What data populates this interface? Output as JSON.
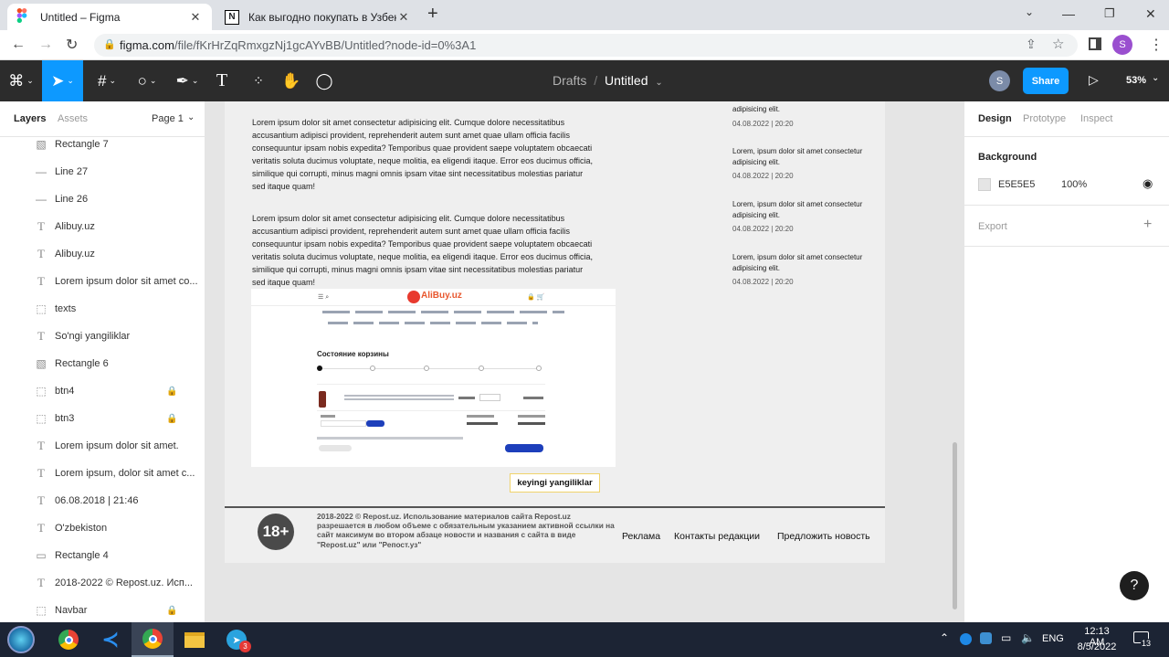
{
  "browser": {
    "tabs": [
      {
        "title": "Untitled – Figma",
        "close": "✕"
      },
      {
        "title": "Как выгодно покупать в Узбеки",
        "close": "✕"
      }
    ],
    "new_tab": "+",
    "url_host": "figma.com",
    "url_path": "/file/fKrHrZqRmxgzNj1gcAYvBB/Untitled?node-id=0%3A1",
    "profile_initial": "S"
  },
  "figma": {
    "breadcrumb_parent": "Drafts",
    "breadcrumb_sep": "/",
    "file_name": "Untitled",
    "user_initial": "S",
    "share_label": "Share",
    "zoom": "53%"
  },
  "layers_panel": {
    "tab_layers": "Layers",
    "tab_assets": "Assets",
    "page": "Page 1",
    "items": [
      {
        "icon": "image-icon",
        "name": "Rectangle 7",
        "locked": false
      },
      {
        "icon": "line-icon",
        "name": "Line 27",
        "locked": false
      },
      {
        "icon": "line-icon",
        "name": "Line 26",
        "locked": false
      },
      {
        "icon": "text-icon",
        "name": "Alibuy.uz",
        "locked": false
      },
      {
        "icon": "text-icon",
        "name": "Alibuy.uz",
        "locked": false
      },
      {
        "icon": "text-icon",
        "name": "Lorem ipsum dolor sit amet co...",
        "locked": false
      },
      {
        "icon": "frame-icon",
        "name": "texts",
        "locked": false
      },
      {
        "icon": "text-icon",
        "name": "So'ngi yangiliklar",
        "locked": false
      },
      {
        "icon": "image-icon",
        "name": "Rectangle 6",
        "locked": false
      },
      {
        "icon": "frame-icon",
        "name": "btn4",
        "locked": true
      },
      {
        "icon": "frame-icon",
        "name": "btn3",
        "locked": true
      },
      {
        "icon": "text-icon",
        "name": "Lorem ipsum dolor sit amet.",
        "locked": false
      },
      {
        "icon": "text-icon",
        "name": "Lorem ipsum, dolor sit amet c...",
        "locked": false
      },
      {
        "icon": "text-icon",
        "name": "06.08.2018 | 21:46",
        "locked": false
      },
      {
        "icon": "text-icon",
        "name": "O'zbekiston",
        "locked": false
      },
      {
        "icon": "rect-icon",
        "name": "Rectangle 4",
        "locked": false
      },
      {
        "icon": "text-icon",
        "name": "2018-2022 © Repost.uz. Исп...",
        "locked": false
      },
      {
        "icon": "frame-icon",
        "name": "Navbar",
        "locked": true
      }
    ]
  },
  "design_panel": {
    "tab_design": "Design",
    "tab_prototype": "Prototype",
    "tab_inspect": "Inspect",
    "background_label": "Background",
    "background_hex": "E5E5E5",
    "background_opacity": "100%",
    "export_label": "Export",
    "add": "+"
  },
  "canvas": {
    "paragraph": "Lorem ipsum dolor sit amet consectetur adipisicing elit. Cumque dolore necessitatibus accusantium adipisci provident, reprehenderit autem sunt amet quae ullam officia facilis consequuntur ipsam nobis expedita? Temporibus quae provident saepe voluptatem obcaecati veritatis soluta ducimus voluptate, neque molitia, ea eligendi itaque. Error eos ducimus officia, similique qui corrupti, minus magni omnis ipsam vitae sint necessitatibus molestias pariatur sed itaque quam!",
    "paragraph2": "Lorem ipsum dolor sit amet consectetur adipisicing elit. Cumque dolore necessitatibus accusantium adipisci provident, reprehenderit autem sunt amet quae ullam officia facilis consequuntur ipsam nobis expedita? Temporibus quae provident saepe voluptatem obcaecati veritatis soluta ducimus voluptate, neque molitia, ea eligendi itaque. Error eos ducimus officia, similique qui corrupti, minus magni omnis ipsam vitae sint necessitatibus molestias pariatur sed itaque quam!",
    "news_top_fragment": "adipisicing elit.",
    "news_top_date": "04.08.2022 | 20:20",
    "news": [
      {
        "text": "Lorem, ipsum dolor sit amet consectetur adipisicing elit.",
        "date": "04.08.2022 | 20:20"
      },
      {
        "text": "Lorem, ipsum dolor sit amet consectetur adipisicing elit.",
        "date": "04.08.2022 | 20:20"
      },
      {
        "text": "Lorem, ipsum dolor sit amet consectetur adipisicing elit.",
        "date": "04.08.2022 | 20:20"
      }
    ],
    "shot_logo": "AliBuy.uz",
    "shot_heading": "Состояние корзины",
    "next_button": "keyingi yangiliklar",
    "footer_age": "18+",
    "footer_text": "2018-2022 © Repost.uz. Использование материалов сайта Repost.uz разрешается в любом объеме с обязательным указанием активной ссылки на сайт максимум во втором абзаце новости и названия с сайта в виде \"Repost.uz\" или \"Репост.уз\"",
    "footer_links": [
      "Реклама",
      "Контакты редакции",
      "Предложить новость"
    ]
  },
  "help": "?",
  "taskbar": {
    "lang": "ENG",
    "time": "12:13 AM",
    "date": "8/5/2022",
    "notif_count": "13",
    "telegram_badge": "3"
  }
}
